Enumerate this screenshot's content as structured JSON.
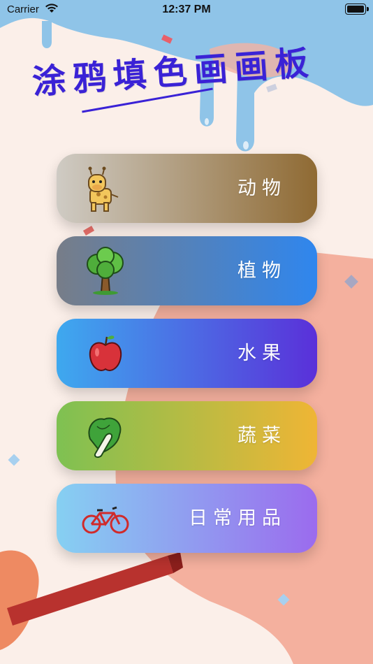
{
  "status_bar": {
    "carrier": "Carrier",
    "time": "12:37 PM"
  },
  "title": "涂鸦填色画画板",
  "menu": [
    {
      "label": "动物",
      "icon": "giraffe-icon",
      "gradient": [
        "#cfcbc4",
        "#8f6a33"
      ]
    },
    {
      "label": "植物",
      "icon": "tree-icon",
      "gradient": [
        "#777d88",
        "#2f86ee"
      ]
    },
    {
      "label": "水果",
      "icon": "apple-icon",
      "gradient": [
        "#3ea9ef",
        "#5a30d9"
      ]
    },
    {
      "label": "蔬菜",
      "icon": "cabbage-icon",
      "gradient": [
        "#7ec152",
        "#efb535"
      ]
    },
    {
      "label": "日常用品",
      "icon": "bicycle-icon",
      "gradient": [
        "#86d0f2",
        "#9b6bee"
      ]
    }
  ],
  "colors": {
    "title": "#3a22d6",
    "background": "#fbefe9",
    "blue_splash": "#8fc4e8",
    "coral_splash": "#f2a590"
  }
}
